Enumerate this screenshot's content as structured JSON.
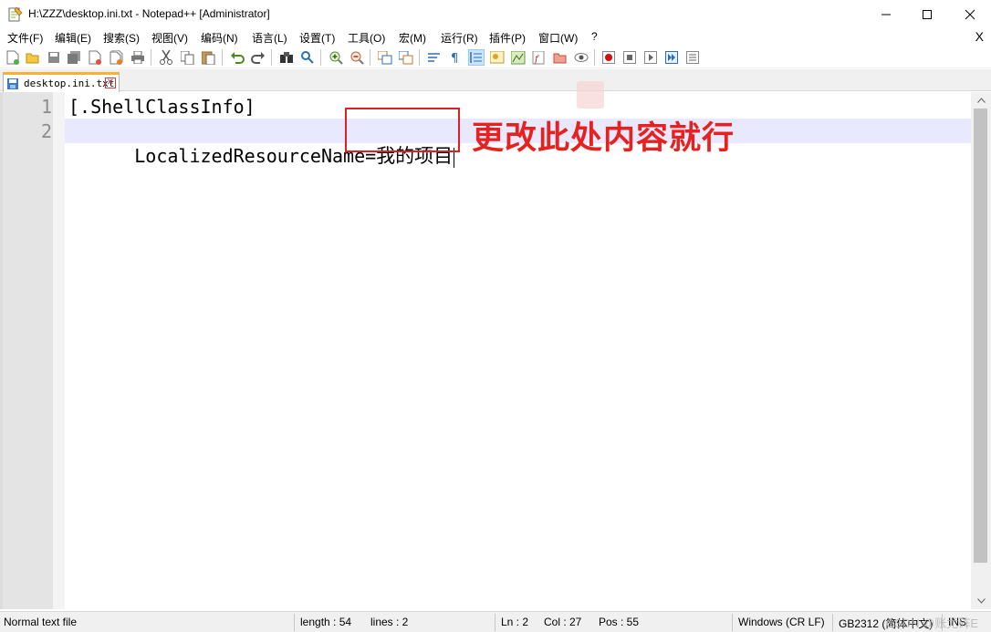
{
  "window": {
    "title": "H:\\ZZZ\\desktop.ini.txt - Notepad++ [Administrator]"
  },
  "menu": {
    "items": [
      "文件(F)",
      "编辑(E)",
      "搜索(S)",
      "视图(V)",
      "编码(N)",
      "语言(L)",
      "设置(T)",
      "工具(O)",
      "宏(M)",
      "运行(R)",
      "插件(P)",
      "窗口(W)",
      "?"
    ],
    "close_label": "X"
  },
  "tab": {
    "label": "desktop.ini.txt"
  },
  "editor": {
    "line_numbers": [
      "1",
      "2"
    ],
    "line1": "[.ShellClassInfo]",
    "line2_key": "LocalizedResourceName=",
    "line2_value": "我的项目",
    "annotation": "更改此处内容就行"
  },
  "status": {
    "file_type": "Normal text file",
    "length": "length : 54",
    "lines": "lines : 2",
    "ln": "Ln : 2",
    "col": "Col : 27",
    "pos": "Pos : 55",
    "eol": "Windows (CR LF)",
    "encoding": "GB2312 (简体中文)",
    "mode": "INS",
    "watermark": "CSDN @账尤砗E"
  },
  "colors": {
    "annotation": "#e8201e",
    "current_line": "#e8e8ff",
    "tab_accent": "#fab032"
  }
}
